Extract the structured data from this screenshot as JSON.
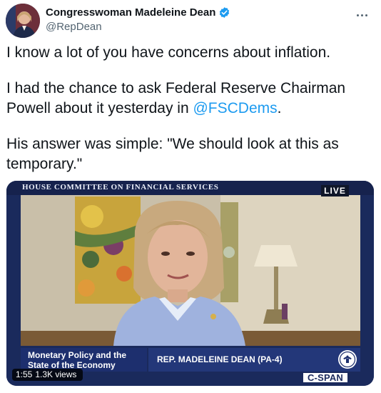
{
  "author": {
    "name": "Congresswoman Madeleine Dean",
    "handle": "@RepDean",
    "verified": true
  },
  "tweet": {
    "line1": "I know a lot of you have concerns about inflation.",
    "line2a": "I had the chance to ask Federal Reserve Chairman",
    "line2b_before": "Powell about it yesterday in ",
    "mention": "@FSCDems",
    "line2b_after": ".",
    "line3a": "His answer was simple: \"We should look at this as",
    "line3b": "temporary.\""
  },
  "media": {
    "banner": "HOUSE COMMITTEE ON FINANCIAL SERVICES",
    "live": "LIVE",
    "topic_line1": "Monetary Policy and the",
    "topic_line2": "State of the Economy",
    "speaker": "REP. MADELEINE DEAN (PA-4)",
    "network": "C-SPAN",
    "duration": "1:55",
    "views": "1.3K views"
  },
  "colors": {
    "mention": "#1d9bf0",
    "verified": "#1d9bf0",
    "cspan_navy": "#1d2f6e"
  },
  "icons": {
    "verified": "verified-badge-icon",
    "more": "more-dots-icon",
    "seal": "congressional-seal-icon"
  }
}
